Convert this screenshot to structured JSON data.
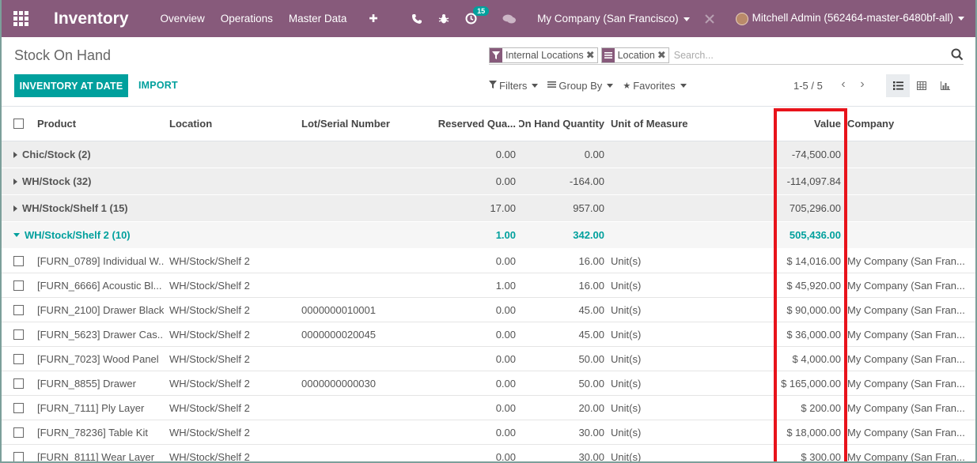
{
  "navbar": {
    "brand": "Inventory",
    "menu": [
      "Overview",
      "Operations",
      "Master Data"
    ],
    "activity_badge": "15",
    "company": "My Company (San Francisco)",
    "user": "Mitchell Admin (562464-master-6480bf-all)"
  },
  "control_panel": {
    "title": "Stock On Hand",
    "primary_button": "INVENTORY AT DATE",
    "secondary_button": "IMPORT",
    "facets": [
      "Internal Locations",
      "Location"
    ],
    "search_placeholder": "Search...",
    "filters_label": "Filters",
    "groupby_label": "Group By",
    "favorites_label": "Favorites",
    "pager": "1-5 / 5"
  },
  "table": {
    "headers": {
      "product": "Product",
      "location": "Location",
      "lot": "Lot/Serial Number",
      "reserved": "Reserved Qua...",
      "onhand": "On Hand Quantity",
      "uom": "Unit of Measure",
      "value": "Value",
      "company": "Company"
    },
    "groups": [
      {
        "label": "Chic/Stock (2)",
        "reserved": "0.00",
        "onhand": "0.00",
        "value": "-74,500.00"
      },
      {
        "label": "WH/Stock (32)",
        "reserved": "0.00",
        "onhand": "-164.00",
        "value": "-114,097.84"
      },
      {
        "label": "WH/Stock/Shelf 1 (15)",
        "reserved": "17.00",
        "onhand": "957.00",
        "value": "705,296.00"
      },
      {
        "label": "WH/Stock/Shelf 2 (10)",
        "reserved": "1.00",
        "onhand": "342.00",
        "value": "505,436.00"
      }
    ],
    "rows": [
      {
        "product": "[FURN_0789] Individual W...",
        "location": "WH/Stock/Shelf 2",
        "lot": "",
        "reserved": "0.00",
        "onhand": "16.00",
        "uom": "Unit(s)",
        "value": "$ 14,016.00",
        "company": "My Company (San Fran..."
      },
      {
        "product": "[FURN_6666] Acoustic Bl...",
        "location": "WH/Stock/Shelf 2",
        "lot": "",
        "reserved": "1.00",
        "onhand": "16.00",
        "uom": "Unit(s)",
        "value": "$ 45,920.00",
        "company": "My Company (San Fran..."
      },
      {
        "product": "[FURN_2100] Drawer Black",
        "location": "WH/Stock/Shelf 2",
        "lot": "0000000010001",
        "reserved": "0.00",
        "onhand": "45.00",
        "uom": "Unit(s)",
        "value": "$ 90,000.00",
        "company": "My Company (San Fran..."
      },
      {
        "product": "[FURN_5623] Drawer Cas...",
        "location": "WH/Stock/Shelf 2",
        "lot": "0000000020045",
        "reserved": "0.00",
        "onhand": "45.00",
        "uom": "Unit(s)",
        "value": "$ 36,000.00",
        "company": "My Company (San Fran..."
      },
      {
        "product": "[FURN_7023] Wood Panel",
        "location": "WH/Stock/Shelf 2",
        "lot": "",
        "reserved": "0.00",
        "onhand": "50.00",
        "uom": "Unit(s)",
        "value": "$ 4,000.00",
        "company": "My Company (San Fran..."
      },
      {
        "product": "[FURN_8855] Drawer",
        "location": "WH/Stock/Shelf 2",
        "lot": "0000000000030",
        "reserved": "0.00",
        "onhand": "50.00",
        "uom": "Unit(s)",
        "value": "$ 165,000.00",
        "company": "My Company (San Fran..."
      },
      {
        "product": "[FURN_7111] Ply Layer",
        "location": "WH/Stock/Shelf 2",
        "lot": "",
        "reserved": "0.00",
        "onhand": "20.00",
        "uom": "Unit(s)",
        "value": "$ 200.00",
        "company": "My Company (San Fran..."
      },
      {
        "product": "[FURN_78236] Table Kit",
        "location": "WH/Stock/Shelf 2",
        "lot": "",
        "reserved": "0.00",
        "onhand": "30.00",
        "uom": "Unit(s)",
        "value": "$ 18,000.00",
        "company": "My Company (San Fran..."
      },
      {
        "product": "[FURN_8111] Wear Layer",
        "location": "WH/Stock/Shelf 2",
        "lot": "",
        "reserved": "0.00",
        "onhand": "30.00",
        "uom": "Unit(s)",
        "value": "$ 300.00",
        "company": "My Company (San Fran..."
      }
    ]
  }
}
